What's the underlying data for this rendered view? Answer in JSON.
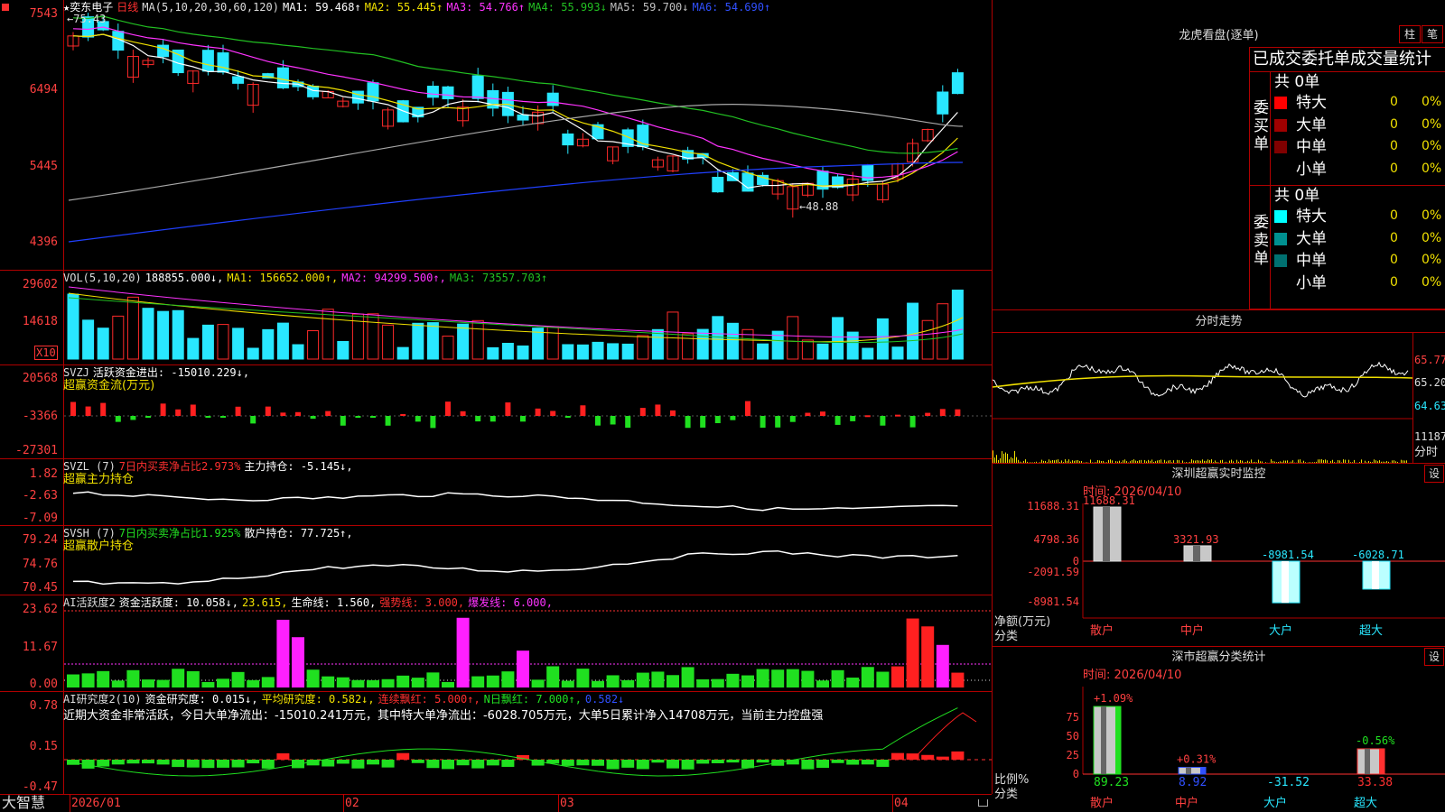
{
  "colors": {
    "up": "#ff2a2a",
    "down": "#29e7ff",
    "ma1": "#ffffff",
    "ma2": "#f0e000",
    "ma3": "#ff33ff",
    "ma4": "#22c022",
    "ma5": "#a0a0a0",
    "ma6": "#2040ff",
    "frame": "#b00000"
  },
  "left_axis": {
    "price": [
      "7543",
      "6494",
      "5445",
      "4396"
    ],
    "vol": [
      "29602",
      "14618"
    ],
    "vol_unit": "X10",
    "svzj": [
      "20568",
      "-3366",
      "-27301"
    ],
    "svzl": [
      "1.82",
      "-2.63",
      "-7.09"
    ],
    "svsh": [
      "79.24",
      "74.76",
      "70.45"
    ],
    "ai1": [
      "23.62",
      "11.67",
      "0.00"
    ],
    "ai2": [
      "0.78",
      "0.15",
      "-0.47"
    ]
  },
  "main_header": {
    "star": "★",
    "stock": "奕东电子",
    "period": "日线",
    "ma_params": "MA(5,10,20,30,60,120)",
    "ma1": "MA1: 59.468↑",
    "ma2": "MA2: 55.445↑",
    "ma3": "MA3: 54.766↑",
    "ma4": "MA4: 55.993↓",
    "ma5": "MA5: 59.700↓",
    "ma6": "MA6: 54.690↑",
    "high_mark": "←75.43",
    "low_mark": "←48.88"
  },
  "vol_header": {
    "label": "VOL(5,10,20)",
    "value": "188855.000↓,",
    "ma1": "MA1: 156652.000↑,",
    "ma2": "MA2: 94299.500↑,",
    "ma3": "MA3: 73557.703↑"
  },
  "svzj_header": {
    "label": "SVZJ",
    "desc": "活跃资金进出: -15010.229↓,",
    "sub": "超赢资金流(万元)"
  },
  "svzl_header": {
    "label": "SVZL (7)",
    "ratio": "7日内买卖净占比2.973%",
    "hold": "主力持仓: -5.145↓,",
    "sub": "超赢主力持仓"
  },
  "svsh_header": {
    "label": "SVSH (7)",
    "ratio": "7日内买卖净占比1.925%",
    "hold": "散户持仓: 77.725↑,",
    "sub": "超赢散户持仓"
  },
  "ai1_header": {
    "label": "AI活跃度2",
    "v1": "资金活跃度: 10.058↓,",
    "v2": "23.615,",
    "v3": "生命线: 1.560,",
    "v4": "强势线: 3.000,",
    "v5": "爆发线: 6.000,"
  },
  "ai2_header": {
    "label": "AI研究度2(10)",
    "v1": "资金研究度: 0.015↓,",
    "v2": "平均研究度: 0.582↓,",
    "v3": "连续飘红: 5.000↑,",
    "v4": "N日飘红: 7.000↑,",
    "v5": "0.582↓",
    "comment": "近期大资金非常活跃，今日大单净流出：-15010.241万元，其中特大单净流出：-6028.705万元，大单5日累计净入14708万元，当前主力控盘强"
  },
  "bottom_axis": {
    "app": "大智慧",
    "dates": [
      "2026/01",
      "02",
      "03",
      "04"
    ]
  },
  "dragon": {
    "title": "龙虎看盘(逐单)",
    "tab_col": "柱",
    "tab_pen": "笔",
    "stats_title": "已成交委托单成交量统计",
    "buy_label": "委买单",
    "sell_label": "委卖单",
    "buy_total": "共 0单",
    "sell_total": "共 0单",
    "buy_rows": [
      {
        "name": "特大",
        "count": "0",
        "pct": "0%",
        "color": "#ff0000"
      },
      {
        "name": "大单",
        "count": "0",
        "pct": "0%",
        "color": "#a00000"
      },
      {
        "name": "中单",
        "count": "0",
        "pct": "0%",
        "color": "#800000"
      },
      {
        "name": "小单",
        "count": "0",
        "pct": "0%",
        "color": ""
      }
    ],
    "sell_rows": [
      {
        "name": "特大",
        "count": "0",
        "pct": "0%",
        "color": "#00ffff"
      },
      {
        "name": "大单",
        "count": "0",
        "pct": "0%",
        "color": "#009090"
      },
      {
        "name": "中单",
        "count": "0",
        "pct": "0%",
        "color": "#007070"
      },
      {
        "name": "小单",
        "count": "0",
        "pct": "0%",
        "color": ""
      }
    ]
  },
  "intraday": {
    "title": "分时走势",
    "prices": [
      "65.77",
      "65.20",
      "64.63"
    ],
    "vol": "11187",
    "tag": "分时"
  },
  "monitor": {
    "title": "深圳超赢实时监控",
    "settings": "设",
    "time": "时间: 2026/04/10",
    "yaxis": [
      "11688.31",
      "4798.36",
      "0",
      "-2091.59",
      "-8981.54"
    ],
    "ylabel": "净额(万元)",
    "xlabel": "分类",
    "bars": [
      {
        "name": "散户",
        "value": 11688.31,
        "label": "11688.31"
      },
      {
        "name": "中户",
        "value": 3321.93,
        "label": "3321.93"
      },
      {
        "name": "大户",
        "value": -8981.54,
        "label": "-8981.54"
      },
      {
        "name": "超大",
        "value": -6028.71,
        "label": "-6028.71"
      }
    ]
  },
  "classify": {
    "title": "深市超赢分类统计",
    "settings": "设",
    "time": "时间: 2026/04/10",
    "yaxis": [
      "75",
      "50",
      "25",
      "0"
    ],
    "ylabel": "比例%",
    "xlabel": "分类",
    "bars": [
      {
        "name": "散户",
        "pct": 89.23,
        "change": "+1.09%",
        "value": "89.23"
      },
      {
        "name": "中户",
        "pct": 8.92,
        "change": "+0.31%",
        "value": "8.92"
      },
      {
        "name": "大户",
        "pct": 0,
        "change": "",
        "value": "-31.52"
      },
      {
        "name": "超大",
        "pct": 33.38,
        "change": "-0.56%",
        "value": "33.38"
      }
    ]
  }
}
